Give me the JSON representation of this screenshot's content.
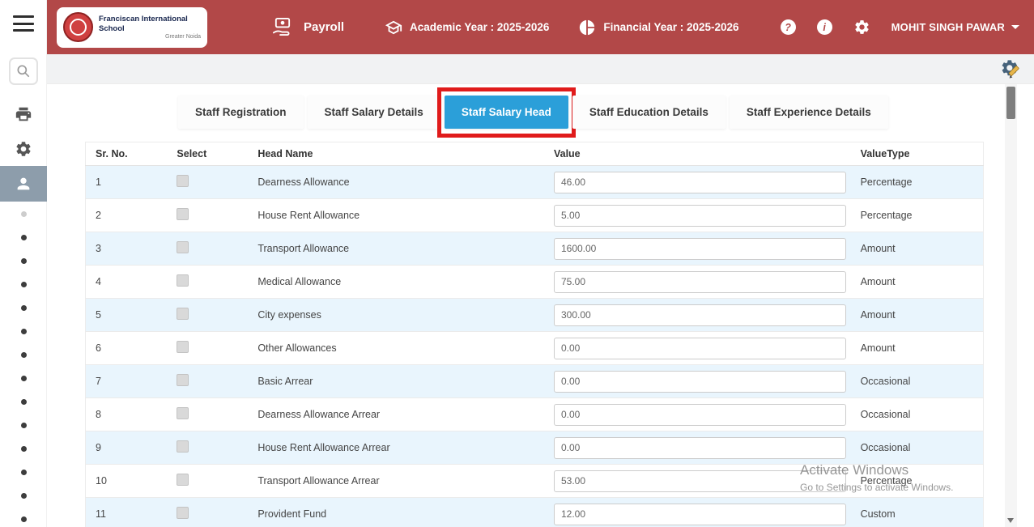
{
  "header": {
    "school_name": "Franciscan International School",
    "school_subtitle": "Greater Noida",
    "module": "Payroll",
    "academic_year": "Academic Year : 2025-2026",
    "financial_year": "Financial Year : 2025-2026",
    "help_label": "?",
    "info_label": "i",
    "user_name": "MOHIT SINGH PAWAR"
  },
  "colors": {
    "header_bg": "#b24848",
    "active_tab": "#2b9fd9",
    "annotation_red": "#e01b1b",
    "sidebar_active_bg": "#8d9dab",
    "row_alt_bg": "#e9f5fd"
  },
  "tabs": [
    {
      "label": "Staff Registration",
      "active": false
    },
    {
      "label": "Staff Salary Details",
      "active": false
    },
    {
      "label": "Staff Salary Head",
      "active": true
    },
    {
      "label": "Staff Education Details",
      "active": false
    },
    {
      "label": "Staff Experience Details",
      "active": false
    }
  ],
  "table": {
    "columns": [
      "Sr. No.",
      "Select",
      "Head Name",
      "Value",
      "ValueType"
    ],
    "rows": [
      {
        "sr": "1",
        "head": "Dearness Allowance",
        "value": "46.00",
        "type": "Percentage"
      },
      {
        "sr": "2",
        "head": "House Rent Allowance",
        "value": "5.00",
        "type": "Percentage"
      },
      {
        "sr": "3",
        "head": "Transport Allowance",
        "value": "1600.00",
        "type": "Amount"
      },
      {
        "sr": "4",
        "head": "Medical Allowance",
        "value": "75.00",
        "type": "Amount"
      },
      {
        "sr": "5",
        "head": "City expenses",
        "value": "300.00",
        "type": "Amount"
      },
      {
        "sr": "6",
        "head": "Other Allowances",
        "value": "0.00",
        "type": "Amount"
      },
      {
        "sr": "7",
        "head": "Basic Arrear",
        "value": "0.00",
        "type": "Occasional"
      },
      {
        "sr": "8",
        "head": "Dearness Allowance Arrear",
        "value": "0.00",
        "type": "Occasional"
      },
      {
        "sr": "9",
        "head": "House Rent Allowance Arrear",
        "value": "0.00",
        "type": "Occasional"
      },
      {
        "sr": "10",
        "head": "Transport Allowance Arrear",
        "value": "53.00",
        "type": "Percentage"
      },
      {
        "sr": "11",
        "head": "Provident Fund",
        "value": "12.00",
        "type": "Custom"
      }
    ]
  },
  "watermark": {
    "line1": "Activate Windows",
    "line2": "Go to Settings to activate Windows."
  }
}
